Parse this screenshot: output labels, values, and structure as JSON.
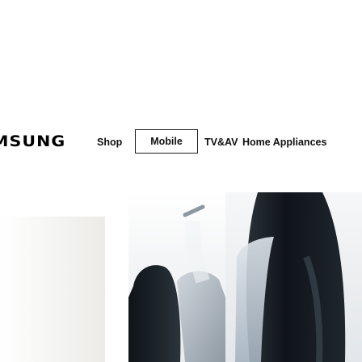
{
  "header": {
    "logo_text": "MSUNG"
  },
  "nav": {
    "items": [
      {
        "label": "Shop"
      },
      {
        "label": "Mobile",
        "selected": true
      },
      {
        "label": "TV&AV"
      },
      {
        "label": "Home Appliances"
      }
    ]
  },
  "colors": {
    "background": "#ffffff",
    "text": "#111111",
    "selected_border": "#1a1a1a",
    "phone_dark": "#101418",
    "phone_light": "#9aa7b6"
  },
  "banner": {
    "images": [
      "phone-left-image",
      "phone-right-image"
    ]
  }
}
